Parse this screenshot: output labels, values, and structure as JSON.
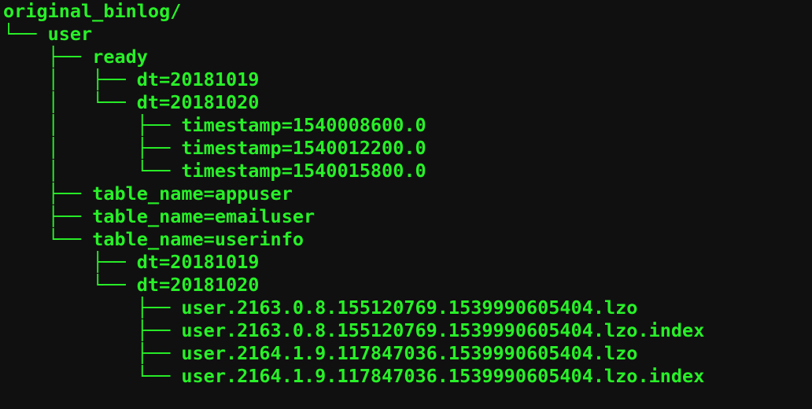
{
  "tree": {
    "root": "original_binlog/",
    "user": "user",
    "ready": "ready",
    "ready_dates": [
      "dt=20181019",
      "dt=20181020"
    ],
    "ready_timestamps": [
      "timestamp=1540008600.0",
      "timestamp=1540012200.0",
      "timestamp=1540015800.0"
    ],
    "tables": [
      "table_name=appuser",
      "table_name=emailuser",
      "table_name=userinfo"
    ],
    "userinfo_dates": [
      "dt=20181019",
      "dt=20181020"
    ],
    "userinfo_files": [
      "user.2163.0.8.155120769.1539990605404.lzo",
      "user.2163.0.8.155120769.1539990605404.lzo.index",
      "user.2164.1.9.117847036.1539990605404.lzo",
      "user.2164.1.9.117847036.1539990605404.lzo.index"
    ]
  },
  "glyphs": {
    "tee": "├── ",
    "elbow": "└── ",
    "pipe": "│   ",
    "blank": "    "
  }
}
